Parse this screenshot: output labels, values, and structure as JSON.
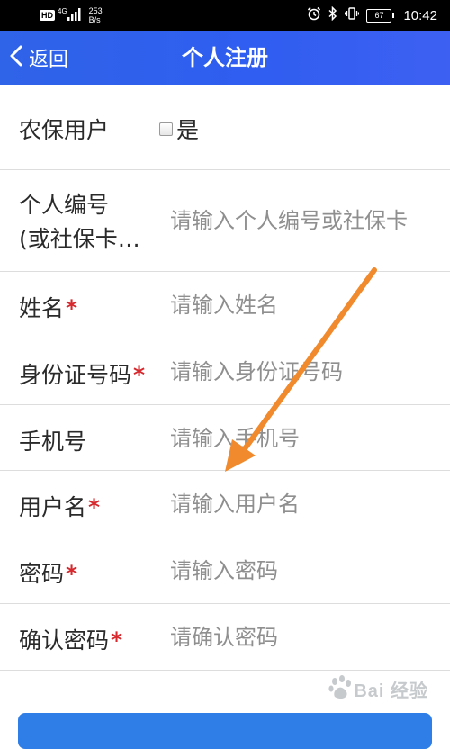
{
  "status_bar": {
    "hd": "HD",
    "network_type": "4G",
    "speed_value": "253",
    "speed_unit": "B/s",
    "battery": "67",
    "time": "10:42",
    "icons": [
      "signal-icon",
      "alarm-icon",
      "bluetooth-icon",
      "vibrate-icon",
      "battery-icon"
    ]
  },
  "nav": {
    "back_label": "返回",
    "title": "个人注册",
    "background": "#2f5ef0"
  },
  "form": {
    "rural_insurance": {
      "label": "农保用户",
      "checkbox_label": "是",
      "checked": false
    },
    "personal_id": {
      "label_line1": "个人编号",
      "label_line2": "(或社保卡…",
      "placeholder": "请输入个人编号或社保卡"
    },
    "name": {
      "label": "姓名",
      "required_mark": "*",
      "placeholder": "请输入姓名"
    },
    "id_card": {
      "label": "身份证号码",
      "required_mark": "*",
      "placeholder": "请输入身份证号码"
    },
    "phone": {
      "label": "手机号",
      "placeholder": "请输入手机号"
    },
    "username": {
      "label": "用户名",
      "required_mark": "*",
      "placeholder": "请输入用户名"
    },
    "password": {
      "label": "密码",
      "required_mark": "*",
      "placeholder": "请输入密码"
    },
    "confirm_password": {
      "label": "确认密码",
      "required_mark": "*",
      "placeholder": "请确认密码"
    }
  },
  "colors": {
    "accent": "#2f5ef0",
    "required": "#d6282d",
    "annotation_arrow": "#f08a2c",
    "submit_button": "#2f7de6"
  },
  "watermark": {
    "text": "Bai 经验",
    "brand": "Baidu"
  }
}
